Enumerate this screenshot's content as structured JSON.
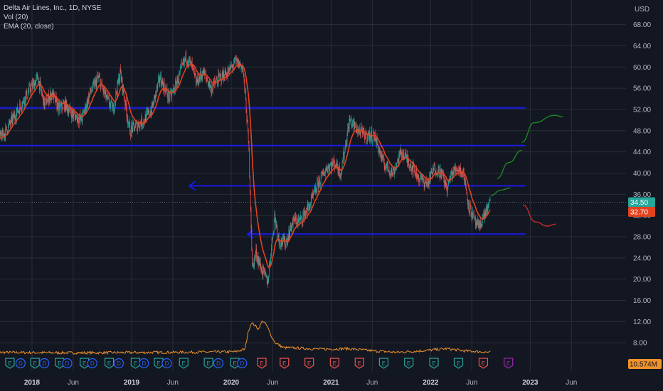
{
  "legend": {
    "symbol": "Delta Air Lines, Inc., 1D, NYSE",
    "volume": "Vol (20)",
    "ema": "EMA (20, close)"
  },
  "colors": {
    "background": "#131722",
    "grid": "#2a2e39",
    "text": "#b2b5be",
    "price_line": "#5d606b",
    "ema": "#e2431e",
    "volume": "#f0922a",
    "levels": "#1a1ae6",
    "projection_up": "#1f8b24",
    "projection_down": "#d32f2f",
    "candle_up": "#26a69a",
    "candle_down": "#ef5350",
    "badge_current": "#26a69a",
    "badge_ema": "#e2431e",
    "badge_volume": "#f0922a",
    "earnings_past_up": "#26a69a",
    "earnings_past_down": "#ef5350",
    "earnings_future": "#9c27b0",
    "dividend": "#2962ff"
  },
  "chart_data": {
    "type": "candlestick",
    "currency": "USD",
    "y_axis_ticks": [
      68,
      64,
      60,
      56,
      52,
      48,
      44,
      40,
      36,
      32,
      28,
      24,
      20,
      16,
      12,
      8
    ],
    "y_tick_labels": [
      "68.00",
      "64.00",
      "60.00",
      "56.00",
      "52.00",
      "48.00",
      "44.00",
      "40.00",
      "36.00",
      "32.00",
      "28.00",
      "24.00",
      "20.00",
      "16.00",
      "12.00",
      "8.00"
    ],
    "x_axis_labels": [
      {
        "label": "2018",
        "date": "2018-01-01",
        "bold": true
      },
      {
        "label": "Jun",
        "date": "2018-06-01"
      },
      {
        "label": "2019",
        "date": "2019-01-01",
        "bold": true
      },
      {
        "label": "Jun",
        "date": "2019-06-01"
      },
      {
        "label": "2020",
        "date": "2020-01-01",
        "bold": true
      },
      {
        "label": "Jun",
        "date": "2020-06-01"
      },
      {
        "label": "2021",
        "date": "2021-01-01",
        "bold": true
      },
      {
        "label": "Jun",
        "date": "2021-06-01"
      },
      {
        "label": "2022",
        "date": "2022-01-01",
        "bold": true
      },
      {
        "label": "Jun",
        "date": "2022-06-01"
      },
      {
        "label": "2023",
        "date": "2023-01-01",
        "bold": true
      },
      {
        "label": "Jun",
        "date": "2023-06-01"
      }
    ],
    "price_path": [
      [
        "2017-08-01",
        46
      ],
      [
        "2017-09-15",
        47
      ],
      [
        "2017-11-01",
        51
      ],
      [
        "2017-12-15",
        55
      ],
      [
        "2018-01-22",
        58
      ],
      [
        "2018-02-15",
        53
      ],
      [
        "2018-03-15",
        55
      ],
      [
        "2018-04-10",
        52
      ],
      [
        "2018-05-01",
        53
      ],
      [
        "2018-06-01",
        51
      ],
      [
        "2018-07-01",
        50
      ],
      [
        "2018-08-01",
        55
      ],
      [
        "2018-09-01",
        58
      ],
      [
        "2018-10-01",
        54
      ],
      [
        "2018-10-25",
        52
      ],
      [
        "2018-11-20",
        59
      ],
      [
        "2018-12-25",
        48
      ],
      [
        "2019-01-20",
        49
      ],
      [
        "2019-02-15",
        50
      ],
      [
        "2019-03-15",
        52
      ],
      [
        "2019-04-15",
        58
      ],
      [
        "2019-05-20",
        54
      ],
      [
        "2019-06-15",
        57
      ],
      [
        "2019-07-20",
        62
      ],
      [
        "2019-08-10",
        60
      ],
      [
        "2019-08-25",
        57
      ],
      [
        "2019-09-20",
        59
      ],
      [
        "2019-10-20",
        56
      ],
      [
        "2019-11-20",
        58
      ],
      [
        "2019-12-20",
        59
      ],
      [
        "2020-01-17",
        61
      ],
      [
        "2020-02-12",
        60
      ],
      [
        "2020-02-24",
        53
      ],
      [
        "2020-03-05",
        45
      ],
      [
        "2020-03-12",
        34
      ],
      [
        "2020-03-18",
        22
      ],
      [
        "2020-04-01",
        25
      ],
      [
        "2020-04-20",
        22
      ],
      [
        "2020-05-14",
        19.5
      ],
      [
        "2020-06-08",
        32
      ],
      [
        "2020-06-25",
        27
      ],
      [
        "2020-07-20",
        27
      ],
      [
        "2020-08-15",
        31
      ],
      [
        "2020-09-10",
        31
      ],
      [
        "2020-10-15",
        34
      ],
      [
        "2020-11-15",
        38
      ],
      [
        "2020-12-15",
        41
      ],
      [
        "2021-01-15",
        42
      ],
      [
        "2021-02-05",
        40
      ],
      [
        "2021-03-10",
        50
      ],
      [
        "2021-04-10",
        48
      ],
      [
        "2021-05-10",
        47
      ],
      [
        "2021-06-10",
        47
      ],
      [
        "2021-07-10",
        42
      ],
      [
        "2021-08-15",
        40
      ],
      [
        "2021-09-15",
        44
      ],
      [
        "2021-10-15",
        42
      ],
      [
        "2021-11-20",
        39
      ],
      [
        "2021-12-20",
        38
      ],
      [
        "2022-01-15",
        41
      ],
      [
        "2022-02-10",
        40
      ],
      [
        "2022-03-01",
        37
      ],
      [
        "2022-03-20",
        40
      ],
      [
        "2022-04-10",
        41
      ],
      [
        "2022-05-01",
        40
      ],
      [
        "2022-05-20",
        34
      ],
      [
        "2022-06-10",
        31
      ],
      [
        "2022-06-25",
        29.5
      ],
      [
        "2022-07-15",
        32
      ],
      [
        "2022-08-08",
        34.5
      ]
    ],
    "ema_note": "EMA (20, close) computed from price_path",
    "volume_path": [
      [
        "2017-08-01",
        6.2
      ],
      [
        "2018-06-01",
        6.1
      ],
      [
        "2019-06-01",
        6.2
      ],
      [
        "2020-01-15",
        6.3
      ],
      [
        "2020-02-20",
        6.8
      ],
      [
        "2020-03-05",
        10.4
      ],
      [
        "2020-03-15",
        11.8
      ],
      [
        "2020-03-25",
        11.4
      ],
      [
        "2020-04-10",
        10.6
      ],
      [
        "2020-04-25",
        12.2
      ],
      [
        "2020-05-10",
        11.3
      ],
      [
        "2020-05-25",
        9.5
      ],
      [
        "2020-06-10",
        8.0
      ],
      [
        "2020-07-10",
        7.1
      ],
      [
        "2020-09-01",
        7.0
      ],
      [
        "2020-12-01",
        6.8
      ],
      [
        "2021-03-01",
        6.9
      ],
      [
        "2021-06-01",
        6.5
      ],
      [
        "2021-09-01",
        6.2
      ],
      [
        "2021-12-01",
        6.5
      ],
      [
        "2022-03-01",
        6.9
      ],
      [
        "2022-05-01",
        6.5
      ],
      [
        "2022-08-08",
        6.2
      ]
    ],
    "horizontal_levels": [
      {
        "price": 52.3,
        "from": "2017-08-01",
        "to": "2022-12-15",
        "arrow_left": false
      },
      {
        "price": 45.2,
        "from": "2017-08-01",
        "to": "2022-12-15",
        "arrow_left": true
      },
      {
        "price": 37.6,
        "from": "2019-08-01",
        "to": "2022-12-15",
        "arrow_left": true
      },
      {
        "price": 28.5,
        "from": "2020-03-01",
        "to": "2022-12-15",
        "arrow_left": true
      }
    ],
    "projections": [
      {
        "color": "up",
        "path": [
          [
            "2022-08-10",
            35.8
          ],
          [
            "2022-09-15",
            36.8
          ],
          [
            "2022-10-20",
            37.2
          ]
        ]
      },
      {
        "color": "up",
        "path": [
          [
            "2022-09-01",
            39.0
          ],
          [
            "2022-10-15",
            42.0
          ],
          [
            "2022-12-01",
            44.3
          ]
        ]
      },
      {
        "color": "up",
        "path": [
          [
            "2022-12-01",
            45.8
          ],
          [
            "2023-01-15",
            49.5
          ],
          [
            "2023-04-01",
            50.9
          ],
          [
            "2023-05-01",
            50.6
          ]
        ]
      },
      {
        "color": "down",
        "path": [
          [
            "2022-12-05",
            34.0
          ],
          [
            "2023-01-20",
            30.8
          ],
          [
            "2023-03-05",
            30.0
          ],
          [
            "2023-04-05",
            30.4
          ]
        ]
      }
    ],
    "event_markers": [
      {
        "type": "D",
        "date": "2017-08-10"
      },
      {
        "type": "E",
        "date": "2017-10-12"
      },
      {
        "type": "D",
        "date": "2017-11-20"
      },
      {
        "type": "E",
        "date": "2018-01-12"
      },
      {
        "type": "D",
        "date": "2018-02-15"
      },
      {
        "type": "E",
        "date": "2018-04-12"
      },
      {
        "type": "D",
        "date": "2018-05-10"
      },
      {
        "type": "E",
        "date": "2018-07-12"
      },
      {
        "type": "D",
        "date": "2018-08-10"
      },
      {
        "type": "E",
        "date": "2018-10-11"
      },
      {
        "type": "D",
        "date": "2018-11-15"
      },
      {
        "type": "E",
        "date": "2019-01-15"
      },
      {
        "type": "D",
        "date": "2019-02-15"
      },
      {
        "type": "E",
        "date": "2019-04-10"
      },
      {
        "type": "D",
        "date": "2019-05-10"
      },
      {
        "type": "E",
        "date": "2019-07-11"
      },
      {
        "type": "E",
        "date": "2019-10-10"
      },
      {
        "type": "D",
        "date": "2019-11-15"
      },
      {
        "type": "E",
        "date": "2020-01-14"
      },
      {
        "type": "D",
        "date": "2020-02-10"
      },
      {
        "type": "E",
        "date": "2020-04-22",
        "down": true
      },
      {
        "type": "E",
        "date": "2020-07-14",
        "down": true
      },
      {
        "type": "E",
        "date": "2020-10-13",
        "down": true
      },
      {
        "type": "E",
        "date": "2021-01-14",
        "down": true
      },
      {
        "type": "E",
        "date": "2021-04-15",
        "down": true
      },
      {
        "type": "E",
        "date": "2021-07-13"
      },
      {
        "type": "E",
        "date": "2021-10-13"
      },
      {
        "type": "E",
        "date": "2022-01-13"
      },
      {
        "type": "E",
        "date": "2022-04-13"
      },
      {
        "type": "E",
        "date": "2022-07-13",
        "down": true
      },
      {
        "type": "E",
        "date": "2022-10-13",
        "future": true
      }
    ],
    "current_price": 34.5,
    "current_price_label": "34.50",
    "ema_value": 32.7,
    "ema_label": "32.70",
    "volume_label": "10.574M"
  }
}
